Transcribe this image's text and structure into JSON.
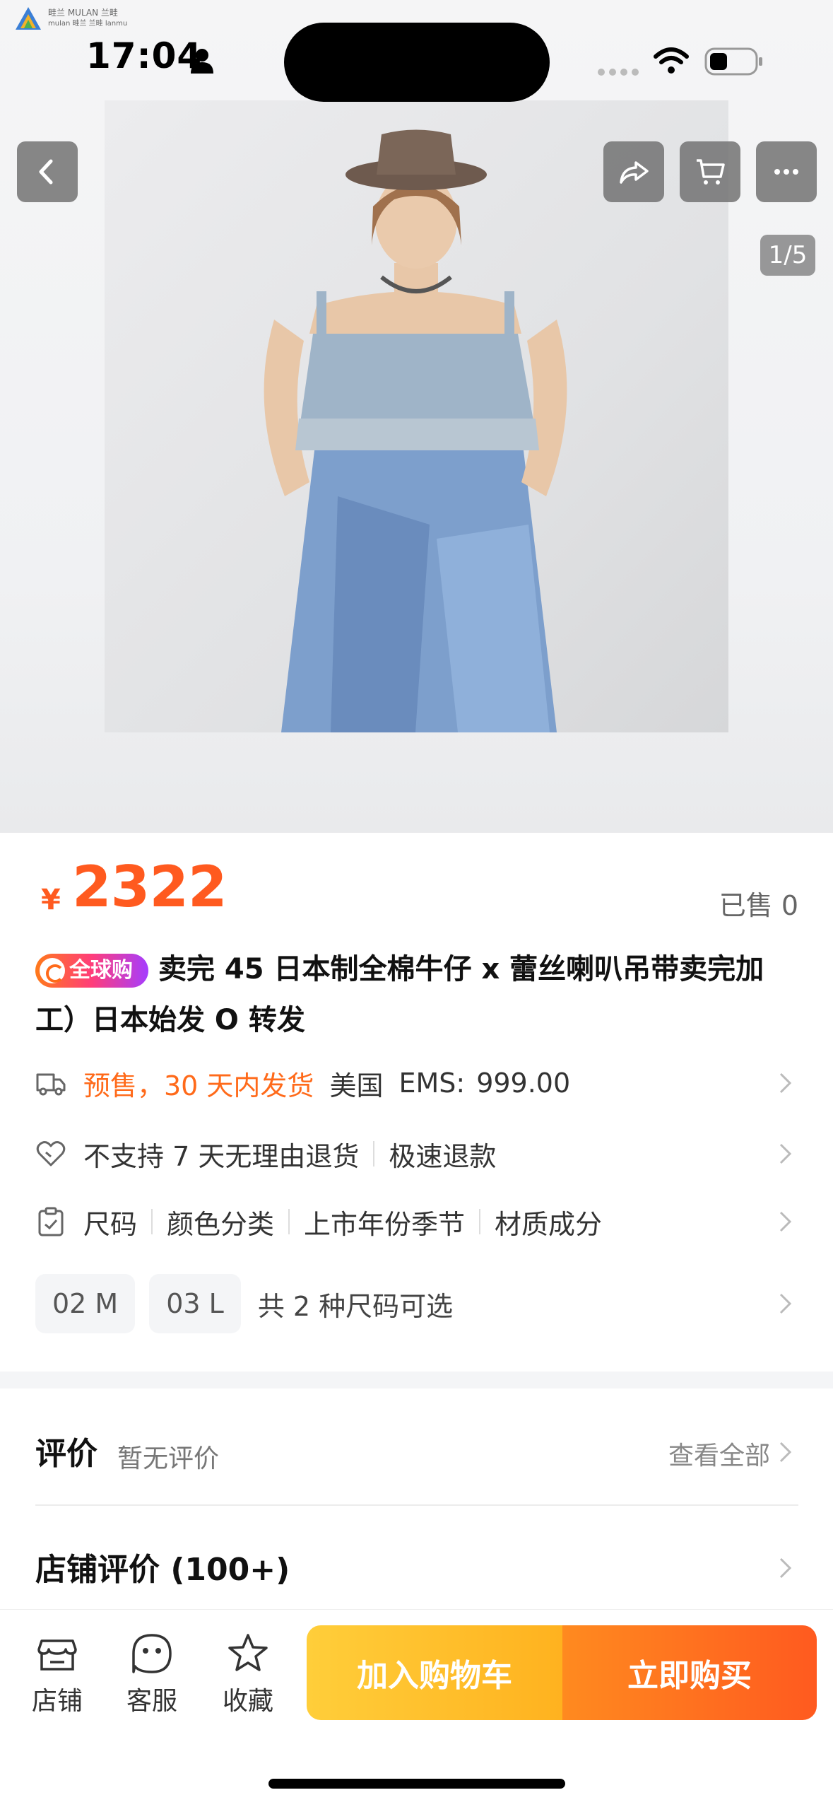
{
  "status_bar": {
    "badge_line1": "畦兰 MULAN 兰畦",
    "badge_line2": "mulan 畦兰 兰畦 lanmu",
    "time": "17:04"
  },
  "gallery": {
    "page_indicator": "1/5",
    "icons": [
      "back-icon",
      "share-icon",
      "cart-icon",
      "more-icon"
    ]
  },
  "product": {
    "currency": "¥",
    "price": "2322",
    "sold": "已售 0",
    "tag": "全球购",
    "title": "卖完 45 日本制全棉牛仔 x 蕾丝喇叭吊带卖完加工）日本始发 O 转发"
  },
  "shipping": {
    "presale": "预售，30 天内发货",
    "country": "美国",
    "ems_label": "EMS:",
    "ems_value": "999.00"
  },
  "returns": {
    "policy": "不支持 7 天无理由退货",
    "fast_refund": "极速退款"
  },
  "attributes": [
    "尺码",
    "颜色分类",
    "上市年份季节",
    "材质成分"
  ],
  "sizes": {
    "options": [
      "02 M",
      "03 L"
    ],
    "summary": "共 2 种尺码可选"
  },
  "reviews": {
    "title": "评价",
    "subtitle": "暂无评价",
    "view_all": "查看全部",
    "shop_title": "店铺评价 (100+)"
  },
  "bottom_bar": {
    "store": "店铺",
    "service": "客服",
    "favorite": "收藏",
    "add_to_cart": "加入购物车",
    "buy_now": "立即购买"
  },
  "colors": {
    "accent": "#ff5a1f",
    "cart_button": "#ffbf2a",
    "buy_button": "#ff6a1f"
  }
}
